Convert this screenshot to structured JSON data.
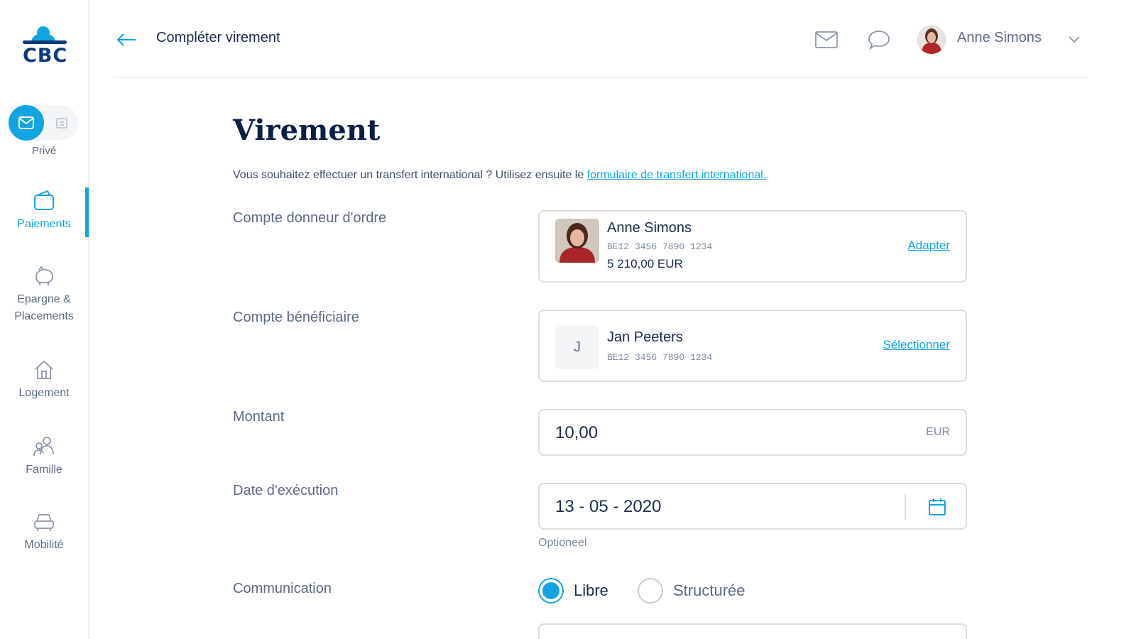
{
  "brand": {
    "logo_text": "CBC",
    "accent": "#12a4e0",
    "navy": "#0b1f45"
  },
  "sidebar": {
    "mode_toggle": {
      "active": "mail-icon",
      "inactive": "building-icon",
      "label": "Privé"
    },
    "items": [
      {
        "label": "Paiements",
        "icon": "wallet-icon",
        "active": true
      },
      {
        "label": "Epargne &",
        "label2": "Placements",
        "icon": "piggy-bank-icon",
        "active": false
      },
      {
        "label": "Logement",
        "icon": "house-icon",
        "active": false
      },
      {
        "label": "Famille",
        "icon": "family-icon",
        "active": false
      },
      {
        "label": "Mobilité",
        "icon": "car-icon",
        "active": false
      }
    ]
  },
  "header": {
    "title": "Compléter virement",
    "back_icon": "arrow-left-icon",
    "mail_icon": "envelope-icon",
    "chat_icon": "chat-bubble-icon",
    "user_name": "Anne Simons",
    "chevron_icon": "chevron-down-icon"
  },
  "main": {
    "page_title": "Virement",
    "intro_text": "Vous souhaitez effectuer un transfert international ? Utilisez ensuite le ",
    "intro_link": "formulaire de transfert international.",
    "ordering_account": {
      "label": "Compte donneur d'ordre",
      "name": "Anne Simons",
      "iban": "BE12 3456 7890 1234",
      "balance": "5 210,00 EUR",
      "action": "Adapter"
    },
    "beneficiary_account": {
      "label": "Compte bénéficiaire",
      "initial": "J",
      "name": "Jan Peeters",
      "iban": "BE12 3456 7890 1234",
      "action": "Sélectionner"
    },
    "amount": {
      "label": "Montant",
      "value": "10,00",
      "unit": "EUR"
    },
    "execution_date": {
      "label": "Date d'exécution",
      "value": "13 - 05 - 2020",
      "hint": "Optioneel"
    },
    "communication": {
      "label": "Communication",
      "options": [
        {
          "label": "Libre",
          "checked": true
        },
        {
          "label": "Structurée",
          "checked": false
        }
      ]
    }
  }
}
